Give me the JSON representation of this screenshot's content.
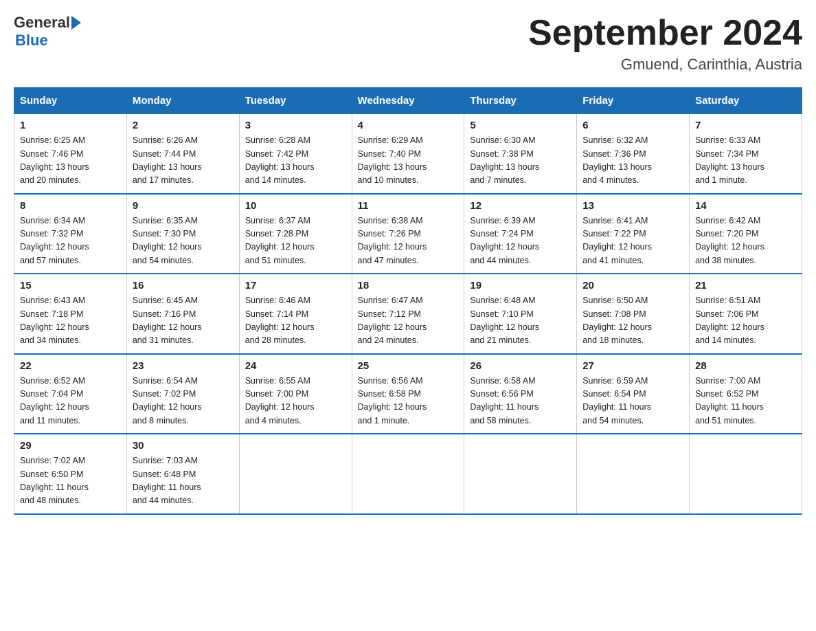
{
  "header": {
    "logo_general": "General",
    "logo_blue": "Blue",
    "month_title": "September 2024",
    "subtitle": "Gmuend, Carinthia, Austria"
  },
  "weekdays": [
    "Sunday",
    "Monday",
    "Tuesday",
    "Wednesday",
    "Thursday",
    "Friday",
    "Saturday"
  ],
  "weeks": [
    [
      {
        "day": "1",
        "sunrise": "6:25 AM",
        "sunset": "7:46 PM",
        "daylight": "13 hours and 20 minutes."
      },
      {
        "day": "2",
        "sunrise": "6:26 AM",
        "sunset": "7:44 PM",
        "daylight": "13 hours and 17 minutes."
      },
      {
        "day": "3",
        "sunrise": "6:28 AM",
        "sunset": "7:42 PM",
        "daylight": "13 hours and 14 minutes."
      },
      {
        "day": "4",
        "sunrise": "6:29 AM",
        "sunset": "7:40 PM",
        "daylight": "13 hours and 10 minutes."
      },
      {
        "day": "5",
        "sunrise": "6:30 AM",
        "sunset": "7:38 PM",
        "daylight": "13 hours and 7 minutes."
      },
      {
        "day": "6",
        "sunrise": "6:32 AM",
        "sunset": "7:36 PM",
        "daylight": "13 hours and 4 minutes."
      },
      {
        "day": "7",
        "sunrise": "6:33 AM",
        "sunset": "7:34 PM",
        "daylight": "13 hours and 1 minute."
      }
    ],
    [
      {
        "day": "8",
        "sunrise": "6:34 AM",
        "sunset": "7:32 PM",
        "daylight": "12 hours and 57 minutes."
      },
      {
        "day": "9",
        "sunrise": "6:35 AM",
        "sunset": "7:30 PM",
        "daylight": "12 hours and 54 minutes."
      },
      {
        "day": "10",
        "sunrise": "6:37 AM",
        "sunset": "7:28 PM",
        "daylight": "12 hours and 51 minutes."
      },
      {
        "day": "11",
        "sunrise": "6:38 AM",
        "sunset": "7:26 PM",
        "daylight": "12 hours and 47 minutes."
      },
      {
        "day": "12",
        "sunrise": "6:39 AM",
        "sunset": "7:24 PM",
        "daylight": "12 hours and 44 minutes."
      },
      {
        "day": "13",
        "sunrise": "6:41 AM",
        "sunset": "7:22 PM",
        "daylight": "12 hours and 41 minutes."
      },
      {
        "day": "14",
        "sunrise": "6:42 AM",
        "sunset": "7:20 PM",
        "daylight": "12 hours and 38 minutes."
      }
    ],
    [
      {
        "day": "15",
        "sunrise": "6:43 AM",
        "sunset": "7:18 PM",
        "daylight": "12 hours and 34 minutes."
      },
      {
        "day": "16",
        "sunrise": "6:45 AM",
        "sunset": "7:16 PM",
        "daylight": "12 hours and 31 minutes."
      },
      {
        "day": "17",
        "sunrise": "6:46 AM",
        "sunset": "7:14 PM",
        "daylight": "12 hours and 28 minutes."
      },
      {
        "day": "18",
        "sunrise": "6:47 AM",
        "sunset": "7:12 PM",
        "daylight": "12 hours and 24 minutes."
      },
      {
        "day": "19",
        "sunrise": "6:48 AM",
        "sunset": "7:10 PM",
        "daylight": "12 hours and 21 minutes."
      },
      {
        "day": "20",
        "sunrise": "6:50 AM",
        "sunset": "7:08 PM",
        "daylight": "12 hours and 18 minutes."
      },
      {
        "day": "21",
        "sunrise": "6:51 AM",
        "sunset": "7:06 PM",
        "daylight": "12 hours and 14 minutes."
      }
    ],
    [
      {
        "day": "22",
        "sunrise": "6:52 AM",
        "sunset": "7:04 PM",
        "daylight": "12 hours and 11 minutes."
      },
      {
        "day": "23",
        "sunrise": "6:54 AM",
        "sunset": "7:02 PM",
        "daylight": "12 hours and 8 minutes."
      },
      {
        "day": "24",
        "sunrise": "6:55 AM",
        "sunset": "7:00 PM",
        "daylight": "12 hours and 4 minutes."
      },
      {
        "day": "25",
        "sunrise": "6:56 AM",
        "sunset": "6:58 PM",
        "daylight": "12 hours and 1 minute."
      },
      {
        "day": "26",
        "sunrise": "6:58 AM",
        "sunset": "6:56 PM",
        "daylight": "11 hours and 58 minutes."
      },
      {
        "day": "27",
        "sunrise": "6:59 AM",
        "sunset": "6:54 PM",
        "daylight": "11 hours and 54 minutes."
      },
      {
        "day": "28",
        "sunrise": "7:00 AM",
        "sunset": "6:52 PM",
        "daylight": "11 hours and 51 minutes."
      }
    ],
    [
      {
        "day": "29",
        "sunrise": "7:02 AM",
        "sunset": "6:50 PM",
        "daylight": "11 hours and 48 minutes."
      },
      {
        "day": "30",
        "sunrise": "7:03 AM",
        "sunset": "6:48 PM",
        "daylight": "11 hours and 44 minutes."
      },
      null,
      null,
      null,
      null,
      null
    ]
  ],
  "labels": {
    "sunrise": "Sunrise:",
    "sunset": "Sunset:",
    "daylight": "Daylight:"
  }
}
